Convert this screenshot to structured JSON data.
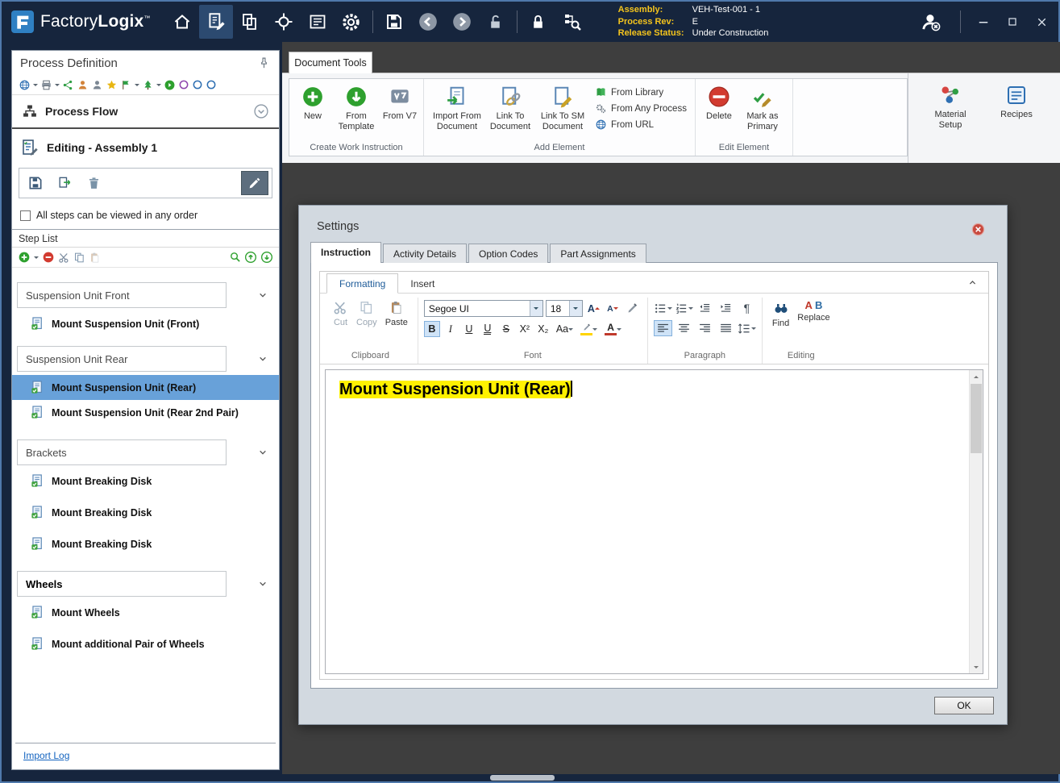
{
  "app": {
    "name_part1": "Factory",
    "name_part2": "Logix",
    "trademark": "™"
  },
  "titlebar": {
    "assembly_label": "Assembly:",
    "assembly_value": "VEH-Test-001 - 1",
    "process_rev_label": "Process Rev:",
    "process_rev_value": "E",
    "release_status_label": "Release Status:",
    "release_status_value": "Under Construction"
  },
  "icons": {
    "home-icon": "house",
    "gear-icon": "gear",
    "save-icon": "floppy-disk",
    "back-icon": "gray-circle-left-arrow",
    "forward-icon": "gray-circle-right-arrow",
    "unlock-icon": "open-padlock",
    "lock-icon": "closed-padlock",
    "pin-icon": "pushpin",
    "add-icon": "green-plus-circle",
    "remove-icon": "red-minus-circle",
    "delete-icon": "red-no-entry-circle",
    "find-icon": "binoculars",
    "close-icon": "red-circle-x",
    "chevron-down-icon": "v-chevron"
  },
  "left_panel": {
    "title": "Process Definition",
    "process_flow_label": "Process Flow",
    "editing_label": "Editing - Assembly 1",
    "any_order_label": "All steps can be viewed in any order",
    "step_list_label": "Step List",
    "groups": [
      {
        "name": "Suspension Unit Front",
        "steps": [
          "Mount Suspension Unit (Front)"
        ]
      },
      {
        "name": "Suspension Unit Rear",
        "steps": [
          "Mount Suspension Unit (Rear)",
          "Mount Suspension Unit (Rear 2nd Pair)"
        ]
      },
      {
        "name": "Brackets",
        "steps": [
          "Mount Breaking Disk",
          "Mount Breaking Disk",
          "Mount Breaking Disk"
        ]
      },
      {
        "name": "Wheels",
        "steps": [
          "Mount Wheels",
          "Mount additional Pair of Wheels"
        ]
      }
    ],
    "selected_step": "Mount Suspension Unit (Rear)",
    "import_log_label": "Import Log"
  },
  "ribbon": {
    "tab_label": "Document Tools",
    "create_group_label": "Create Work Instruction",
    "new_label": "New",
    "from_template_label": "From Template",
    "from_v7_label": "From V7",
    "add_group_label": "Add Element",
    "import_from_document_label": "Import From Document",
    "link_to_document_label": "Link To Document",
    "link_to_sm_document_label": "Link To SM Document",
    "from_library_label": "From Library",
    "from_any_process_label": "From Any Process",
    "from_url_label": "From URL",
    "edit_group_label": "Edit Element",
    "delete_label": "Delete",
    "mark_as_primary_label": "Mark as Primary",
    "material_setup_label": "Material Setup",
    "recipes_label": "Recipes"
  },
  "settings": {
    "title": "Settings",
    "tabs": [
      "Instruction",
      "Activity Details",
      "Option Codes",
      "Part Assignments"
    ],
    "active_tab": "Instruction",
    "formatting_tab": "Formatting",
    "insert_tab": "Insert",
    "clipboard_group_label": "Clipboard",
    "cut_label": "Cut",
    "copy_label": "Copy",
    "paste_label": "Paste",
    "font_group_label": "Font",
    "font_family_value": "Segoe UI",
    "font_size_value": "18",
    "font_buttons": {
      "grow_font": "A",
      "shrink_font": "A",
      "bold": "B",
      "italic": "I",
      "underline": "U",
      "double_underline": "U",
      "strikethrough": "S",
      "superscript": "X²",
      "subscript": "X₂",
      "change_case": "Aa",
      "font_color": "A"
    },
    "paragraph_group_label": "Paragraph",
    "paragraph_mark": "¶",
    "editing_group_label": "Editing",
    "find_label": "Find",
    "replace_label": "Replace",
    "replace_letters": {
      "a": "A",
      "b": "B"
    },
    "editor_content": "Mount Suspension Unit (Rear)",
    "ok_label": "OK"
  }
}
